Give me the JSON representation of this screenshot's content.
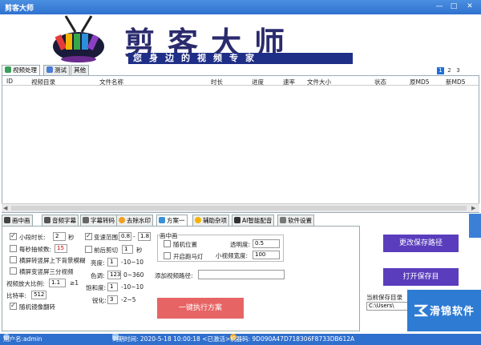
{
  "window": {
    "title": "剪客大师",
    "min": "—",
    "max": "□",
    "close": "✕"
  },
  "banner": {
    "brand": "剪客大师",
    "slogan": "您身边的视频专家",
    "pages": [
      "1",
      "2",
      "3"
    ]
  },
  "top_tabs": [
    "视频处理",
    "测试",
    "其他"
  ],
  "table": {
    "columns": [
      "ID",
      "视频目录",
      "文件名称",
      "时长",
      "进度",
      "速率",
      "文件大小",
      "状态",
      "原MD5",
      "新MD5"
    ]
  },
  "bottom_tabs": [
    "画中画",
    "音频字幕",
    "字幕转码",
    "去除水印",
    "方案一",
    "辅助杂项",
    "AI智能配音",
    "软件设置"
  ],
  "panel": {
    "small_duration_label": "小段时长:",
    "small_duration_value": "2",
    "small_duration_unit": "秒",
    "per_sec_label": "每秒抽帧数:",
    "per_sec_value": "15",
    "landscape1": "横屏转竖屏上下背景模糊",
    "landscape2": "横屏变竖屏三分视频",
    "zoom_label": "视频放大比例:",
    "zoom_value": "1.1",
    "zoom_suffix": "≥1",
    "bitrate_label": "比特率:",
    "bitrate_value": "512",
    "mirror_label": "随机镜像翻转",
    "speed_label": "变速范围",
    "speed_min": "0.8",
    "speed_sep": "-",
    "speed_max": "1.8",
    "cut_label": "前后剪切",
    "cut_value": "1",
    "cut_unit": "秒",
    "bright_label": "亮度:",
    "bright_value": "1",
    "bright_range": "-10~10",
    "hue_label": "色调:",
    "hue_value": "123",
    "hue_range": "0~360",
    "sat_label": "饱和度:",
    "sat_value": "1",
    "sat_range": "-10~10",
    "sharp_label": "锐化:",
    "sharp_value": "3",
    "sharp_range": "-2~5",
    "pip_group": "画中画",
    "random_pos": "随机位置",
    "marquee": "开启跑马灯",
    "opacity_label": "透明度:",
    "opacity_value": "0.5",
    "small_w_label": "小视频宽度:",
    "small_w_value": "100",
    "add_path_label": "添加视频路径:",
    "add_path_value": "",
    "run_button": "一键执行方案"
  },
  "right": {
    "change_save": "更改保存路径",
    "open_save": "打开保存目",
    "cur_save_label": "当前保存目录",
    "cur_save_value": "C:\\Users\\"
  },
  "status": {
    "user": "用户名:admin",
    "expire": "到期时间: 2020-5-18 10:00:18 <已激活>",
    "machine": "机器码: 9D090A47D718306F8733DB612A"
  },
  "watermark": "滑锦软件",
  "colors": {
    "title": "#2f72cf",
    "accent": "#5a3dbd",
    "run": "#e76464"
  }
}
